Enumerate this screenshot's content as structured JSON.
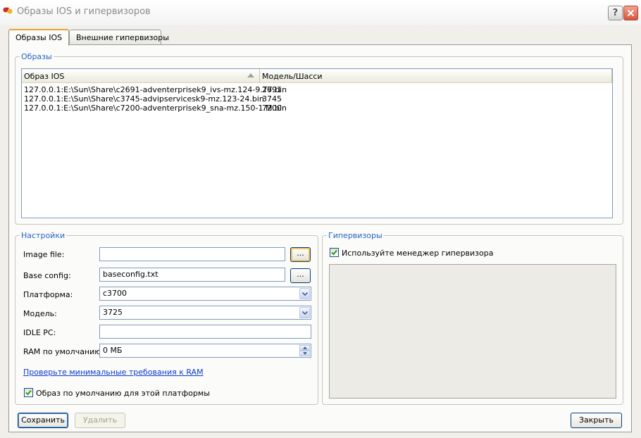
{
  "window": {
    "title": "Образы IOS и гипервизоров",
    "help_label": "?",
    "close_label": "×"
  },
  "tabs": [
    {
      "label": "Образы IOS",
      "active": true
    },
    {
      "label": "Внешние гипервизоры",
      "active": false
    }
  ],
  "images_group": {
    "legend": "Образы",
    "columns": [
      "Образ IOS",
      "Модель/Шасси"
    ],
    "rows": [
      {
        "image": "127.0.0.1:E:\\Sun\\Share\\c2691-adventerprisek9_ivs-mz.124-9.T7.bin",
        "model": "2691"
      },
      {
        "image": "127.0.0.1:E:\\Sun\\Share\\c3745-advipservicesk9-mz.123-24.bin",
        "model": "3745"
      },
      {
        "image": "127.0.0.1:E:\\Sun\\Share\\c7200-adventerprisek9_sna-mz.150-1.M.bin",
        "model": "7200"
      }
    ]
  },
  "settings": {
    "legend": "Настройки",
    "image_file_label": "Image file:",
    "image_file_value": "",
    "base_config_label": "Base config:",
    "base_config_value": "baseconfig.txt",
    "browse_label": "...",
    "platform_label": "Платформа:",
    "platform_value": "c3700",
    "model_label": "Модель:",
    "model_value": "3725",
    "idle_pc_label": "IDLE PC:",
    "idle_pc_value": "",
    "ram_label": "RAM по умолчанию:",
    "ram_value": "0 МБ",
    "ram_link": "Проверьте минимальные требования к RAM",
    "default_image_label": "Образ по умолчанию для этой платформы",
    "default_image_checked": true
  },
  "hypervisors": {
    "legend": "Гипервизоры",
    "use_manager_label": "Используйте менеджер гипервизора",
    "use_manager_checked": true
  },
  "footer": {
    "save_label": "Сохранить",
    "delete_label": "Удалить",
    "close_label": "Закрыть"
  },
  "colors": {
    "legend_text": "#2466c8",
    "link": "#0b3bd2",
    "check": "#21a121"
  }
}
